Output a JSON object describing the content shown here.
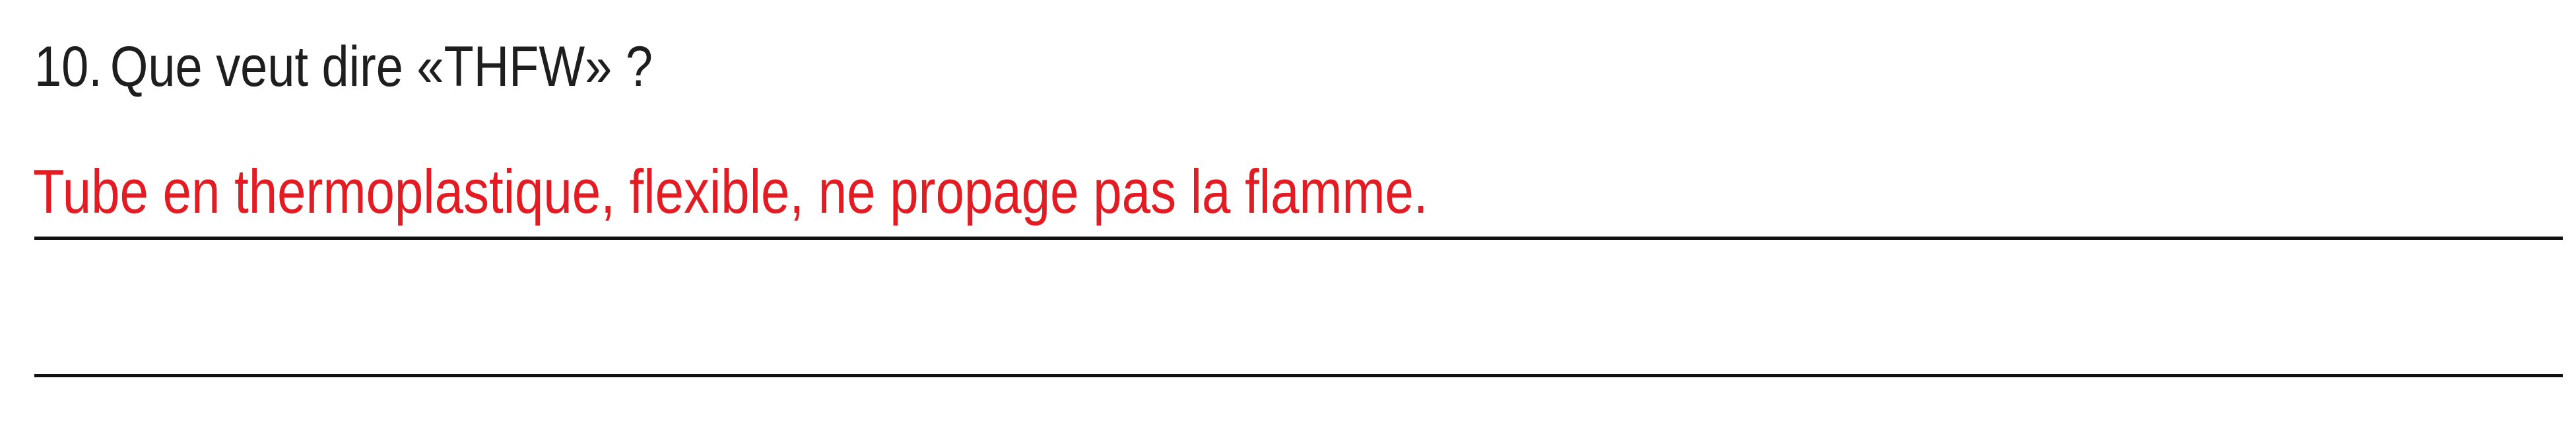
{
  "question": {
    "number": "10.",
    "text": "Que veut dire «THFW» ?"
  },
  "answer": {
    "text": "Tube en thermoplastique, flexible, ne propage pas la flamme.",
    "color": "#e31b23"
  },
  "colors": {
    "text": "#1e1e1e",
    "rule": "#111111"
  }
}
